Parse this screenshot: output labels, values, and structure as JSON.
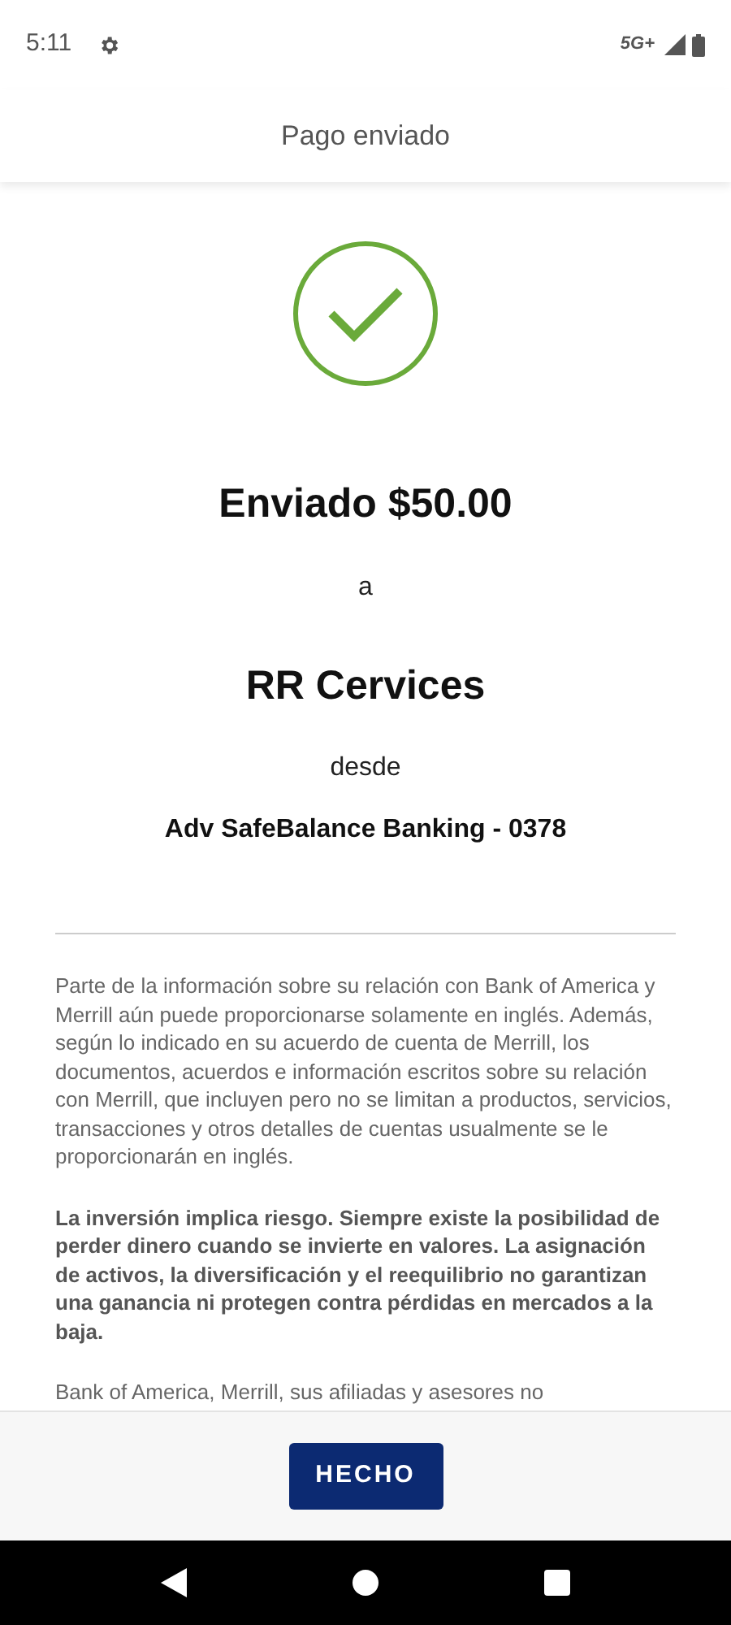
{
  "status_bar": {
    "time": "5:11",
    "network": "5G+"
  },
  "header": {
    "title": "Pago enviado"
  },
  "confirmation": {
    "sent_label": "Enviado $50.00",
    "to_label": "a",
    "payee": "RR Cervices",
    "from_label": "desde",
    "account": "Adv SafeBalance Banking - 0378"
  },
  "disclosures": [
    {
      "text": "Parte de la información sobre su relación con Bank of America y Merrill aún puede proporcionarse solamente en inglés. Además, según lo indicado en su acuerdo de cuenta de Merrill, los documentos, acuerdos e información escritos sobre su relación con Merrill, que incluyen pero no se limitan a productos, servicios, transacciones y otros detalles de cuentas usualmente se le proporcionarán en inglés.",
      "emphasized": false
    },
    {
      "text": "La inversión implica riesgo. Siempre existe la posibilidad de perder dinero cuando se invierte en valores. La asignación de activos, la diversificación y el reequilibrio no garantizan una ganancia ni protegen contra pérdidas en mercados a la baja.",
      "emphasized": true
    },
    {
      "text": "Bank of America, Merrill, sus afiliadas y asesores no",
      "emphasized": false
    }
  ],
  "footer": {
    "button": "HECHO"
  }
}
